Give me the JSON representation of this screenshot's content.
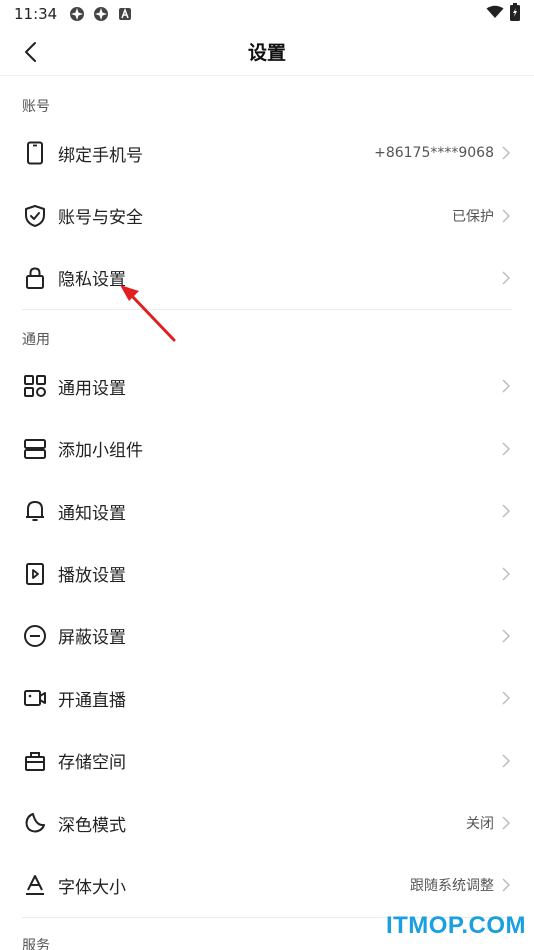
{
  "status_bar": {
    "time": "11:34"
  },
  "nav": {
    "title": "设置",
    "back_icon": "chevron-left-icon"
  },
  "sections": {
    "account": {
      "header": "账号",
      "items": [
        {
          "label": "绑定手机号",
          "value": "+86175****9068",
          "icon": "phone-icon"
        },
        {
          "label": "账号与安全",
          "value": "已保护",
          "icon": "shield-icon"
        },
        {
          "label": "隐私设置",
          "value": "",
          "icon": "lock-icon"
        }
      ]
    },
    "general": {
      "header": "通用",
      "items": [
        {
          "label": "通用设置",
          "value": "",
          "icon": "grid-icon"
        },
        {
          "label": "添加小组件",
          "value": "",
          "icon": "widget-icon"
        },
        {
          "label": "通知设置",
          "value": "",
          "icon": "bell-icon"
        },
        {
          "label": "播放设置",
          "value": "",
          "icon": "play-icon"
        },
        {
          "label": "屏蔽设置",
          "value": "",
          "icon": "block-icon"
        },
        {
          "label": "开通直播",
          "value": "",
          "icon": "video-camera-icon"
        },
        {
          "label": "存储空间",
          "value": "",
          "icon": "storage-icon"
        },
        {
          "label": "深色模式",
          "value": "关闭",
          "icon": "moon-icon"
        },
        {
          "label": "字体大小",
          "value": "跟随系统调整",
          "icon": "font-size-icon"
        }
      ]
    },
    "service": {
      "header": "服务"
    }
  },
  "watermark": "ITMOP.COM",
  "colors": {
    "annotation_arrow": "#e02020",
    "watermark": "#1a9fe0"
  }
}
